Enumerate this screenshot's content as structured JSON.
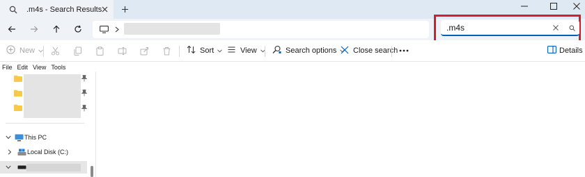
{
  "tab": {
    "title": ".m4s - Search Results"
  },
  "search": {
    "value": ".m4s"
  },
  "toolbar": {
    "new_label": "New",
    "sort_label": "Sort",
    "view_label": "View",
    "search_options_label": "Search options",
    "close_search_label": "Close search",
    "details_label": "Details"
  },
  "menu": {
    "items": [
      "File",
      "Edit",
      "View",
      "Tools"
    ]
  },
  "nav": {
    "this_pc_label": "This PC",
    "local_disk_label": "Local Disk (C:)"
  },
  "colors": {
    "accent": "#005fb8",
    "highlight_box": "#d0212b",
    "folder": "#f7c94b",
    "title_bar": "#dfe9f3",
    "toolbar_bg": "#eff3f8"
  }
}
